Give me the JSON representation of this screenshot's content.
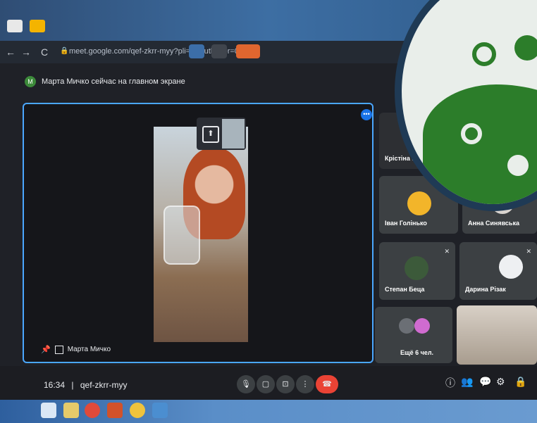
{
  "browser": {
    "url": "meet.google.com/qef-zkrr-myy?pli=1&authuser=0"
  },
  "meet": {
    "presenter_avatar": "M",
    "presenter_banner": "Марта Мичко сейчас на главном экране",
    "main_tile_name": "Марта Мичко",
    "participants": [
      {
        "name": "Крістіна Коцаба"
      },
      {
        "name": "Іван Голінько"
      },
      {
        "name": "Анна Синявська"
      },
      {
        "name": "Степан Беца"
      },
      {
        "name": "Дарина Різак"
      },
      {
        "name": "Ещё 6 чел."
      }
    ],
    "clock": "16:34",
    "separator": "|",
    "meeting_code": "qef-zkrr-myy"
  },
  "icons": {
    "nav_back": "←",
    "nav_forward": "→",
    "reload": "C",
    "lock": "🔒",
    "more": "•••",
    "mic": "🎙",
    "camera": "▢",
    "present": "⊡",
    "more_vert": "⋮",
    "end_call": "☎",
    "info": "ⓘ",
    "people": "👥",
    "chat": "💬",
    "activities": "⚙",
    "lock_host": "🔒",
    "pin": "📌",
    "upload": "⬆"
  }
}
